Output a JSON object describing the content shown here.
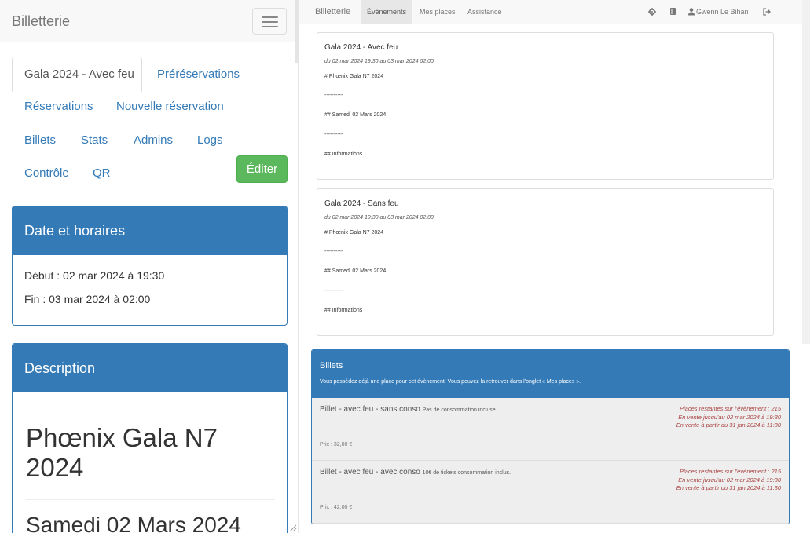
{
  "left": {
    "brand": "Billetterie",
    "tabs": {
      "active": "Gala 2024 - Avec feu",
      "prereservations": "Préréservations",
      "reservations": "Réservations",
      "nouvelle": "Nouvelle réservation",
      "billets": "Billets",
      "stats": "Stats",
      "admins": "Admins",
      "logs": "Logs",
      "controle": "Contrôle",
      "qr": "QR"
    },
    "edit_label": "Éditer",
    "date_panel": {
      "title": "Date et horaires",
      "debut": "Début : 02 mar 2024 à 19:30",
      "fin": "Fin : 03 mar 2024 à 02:00"
    },
    "desc_panel": {
      "title": "Description",
      "h1": "Phœnix Gala N7 2024",
      "h2": "Samedi 02 Mars 2024"
    }
  },
  "right": {
    "nav": {
      "brand": "Billetterie",
      "evenements": "Événements",
      "mes_places": "Mes places",
      "assistance": "Assistance",
      "user": "Gwenn Le Bihan"
    },
    "events": [
      {
        "title": "Gala 2024 - Avec feu",
        "dates": "du 02 mar 2024 19:30 au 03 mar 2024 02:00",
        "line1": "# Phœnix Gala N7 2024",
        "sep": "----------",
        "line2": "## Samedi 02 Mars 2024",
        "line3": "## Informations"
      },
      {
        "title": "Gala 2024 - Sans feu",
        "dates": "du 02 mar 2024 19:30 au 03 mar 2024 02:00",
        "line1": "# Phœnix Gala N7 2024",
        "sep": "----------",
        "line2": "## Samedi 02 Mars 2024",
        "line3": "## Informations"
      }
    ],
    "billets": {
      "title": "Billets",
      "info": "Vous possédez déjà une place pour cet évènement. Vous pouvez la retrouver dans l'onglet « Mes places ».",
      "tickets": [
        {
          "name": "Billet - avec feu - sans conso",
          "desc": "Pas de consommation incluse.",
          "price": "Prix : 32,00 €",
          "places": "Places restantes sur l'évènement : 215",
          "until": "En vente jusqu'au 02 mar 2024 à 19:30",
          "from": "En vente à partir du 31 jan 2024 à 11:30"
        },
        {
          "name": "Billet - avec feu - avec conso",
          "desc": "10€ de tickets consommation inclus.",
          "price": "Prix : 42,00 €",
          "places": "Places restantes sur l'évènement : 215",
          "until": "En vente jusqu'au 02 mar 2024 à 19:30",
          "from": "En vente à partir du 31 jan 2024 à 11:30"
        }
      ]
    }
  }
}
